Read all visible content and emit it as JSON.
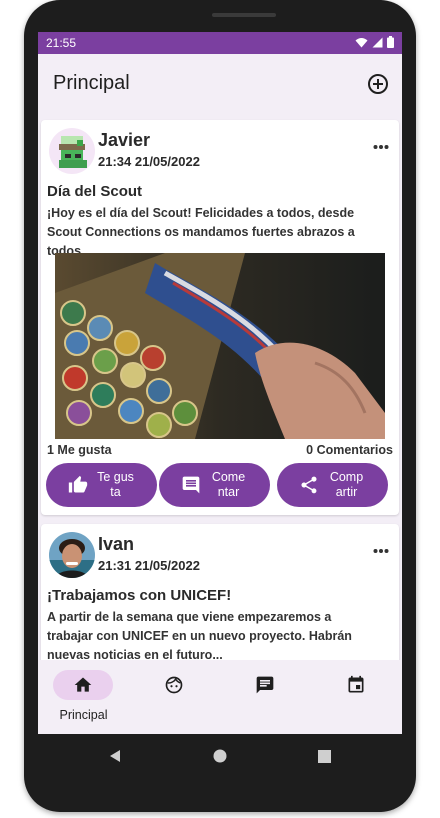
{
  "status_bar": {
    "time": "21:55"
  },
  "app_bar": {
    "title": "Principal"
  },
  "posts": [
    {
      "author": "Javier",
      "datetime": "21:34 21/05/2022",
      "title": "Día del Scout",
      "body": "¡Hoy es el día del Scout! Felicidades a todos, desde Scout Connections os mandamos fuertes abrazos a todos.",
      "likes": "1 Me gusta",
      "comments": "0 Comentarios",
      "actions": {
        "like": "Te gusta",
        "comment": "Comentar",
        "share": "Compartir"
      }
    },
    {
      "author": "Ivan",
      "datetime": "21:31 21/05/2022",
      "title": "¡Trabajamos con UNICEF!",
      "body": "A partir de la semana que viene empezaremos a trabajar con UNICEF en un nuevo proyecto. Habrán nuevas noticias en el futuro..."
    }
  ],
  "bottom_nav": {
    "items": [
      {
        "label": "Principal",
        "icon": "home-icon",
        "selected": true
      },
      {
        "label": "",
        "icon": "face-icon",
        "selected": false
      },
      {
        "label": "",
        "icon": "chat-icon",
        "selected": false
      },
      {
        "label": "",
        "icon": "calendar-icon",
        "selected": false
      }
    ]
  },
  "colors": {
    "primary": "#7b3fa0",
    "background": "#f3eef6",
    "nav_selected": "#ead0ee"
  }
}
